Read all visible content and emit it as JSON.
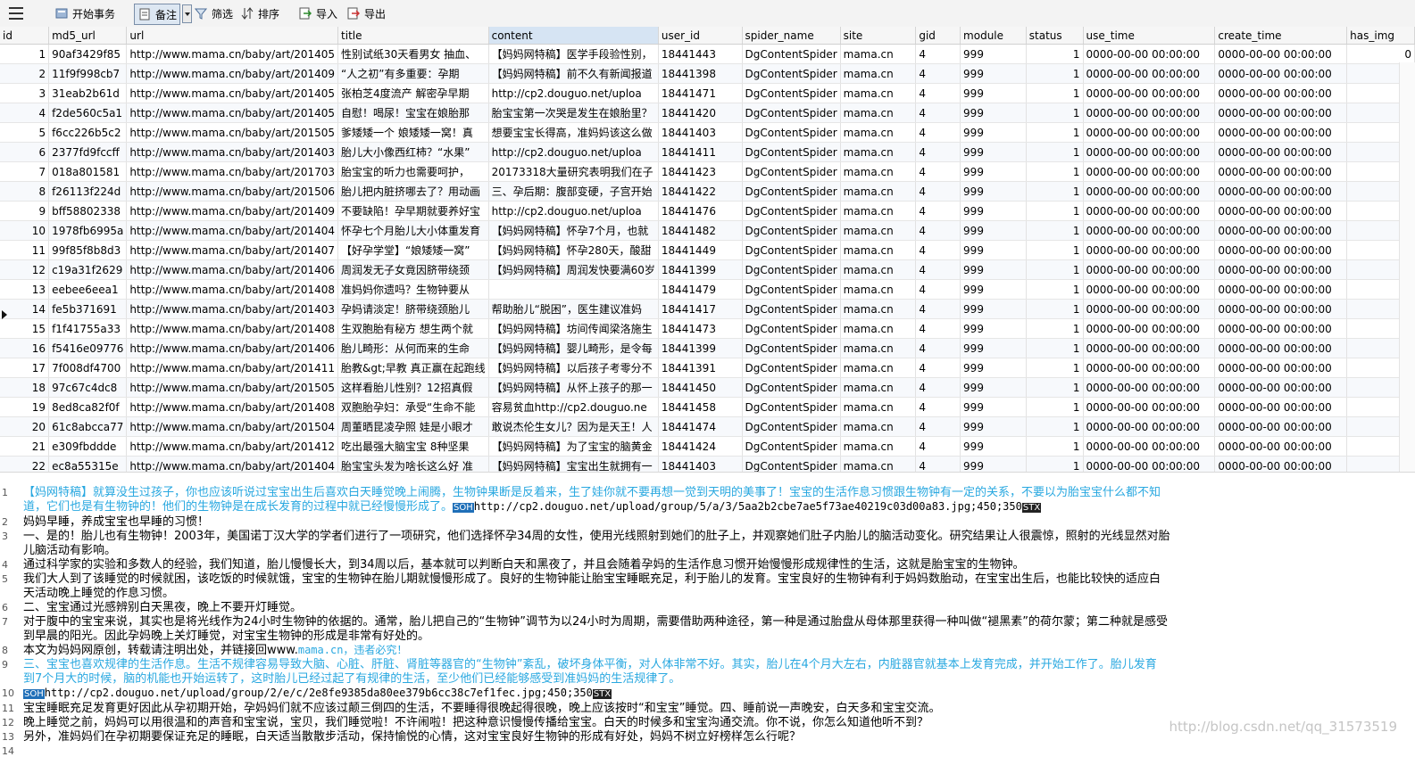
{
  "toolbar": {
    "begin": "开始事务",
    "remark": "备注",
    "filter": "筛选",
    "sort": "排序",
    "import": "导入",
    "export": "导出"
  },
  "columns": [
    "id",
    "md5_url",
    "url",
    "title",
    "content",
    "user_id",
    "spider_name",
    "site",
    "gid",
    "module",
    "status",
    "use_time",
    "create_time",
    "has_img"
  ],
  "rows": [
    [
      "1",
      "90af3429f85",
      "http://www.mama.cn/baby/art/201405",
      "性别试纸30天看男女 抽血、",
      "【妈妈网特稿】医学手段验性别，",
      "18441443",
      "DgContentSpider",
      "mama.cn",
      "4",
      "999",
      "1",
      "0000-00-00 00:00:00",
      "0000-00-00 00:00:00",
      "0"
    ],
    [
      "2",
      "11f9f998cb7",
      "http://www.mama.cn/baby/art/201409",
      "“人之初”有多重要：孕期",
      "【妈妈网特稿】前不久有新闻报道",
      "18441398",
      "DgContentSpider",
      "mama.cn",
      "4",
      "999",
      "1",
      "0000-00-00 00:00:00",
      "0000-00-00 00:00:00",
      "0"
    ],
    [
      "3",
      "31eab2b61d",
      "http://www.mama.cn/baby/art/201405",
      "张柏芝4度流产 解密孕早期",
      "http://cp2.douguo.net/uploa",
      "18441471",
      "DgContentSpider",
      "mama.cn",
      "4",
      "999",
      "1",
      "0000-00-00 00:00:00",
      "0000-00-00 00:00:00",
      "0"
    ],
    [
      "4",
      "f2de560c5a1",
      "http://www.mama.cn/baby/art/201405",
      "自慰！喝尿！宝宝在娘胎那",
      "胎宝宝第一次哭是发生在娘胎里？",
      "18441420",
      "DgContentSpider",
      "mama.cn",
      "4",
      "999",
      "1",
      "0000-00-00 00:00:00",
      "0000-00-00 00:00:00",
      "0"
    ],
    [
      "5",
      "f6cc226b5c2",
      "http://www.mama.cn/baby/art/201505",
      "爹矮矮一个 娘矮矮一窝！真",
      "想要宝宝长得高，准妈妈该这么做",
      "18441403",
      "DgContentSpider",
      "mama.cn",
      "4",
      "999",
      "1",
      "0000-00-00 00:00:00",
      "0000-00-00 00:00:00",
      "0"
    ],
    [
      "6",
      "2377fd9fccff",
      "http://www.mama.cn/baby/art/201403",
      "胎儿大小像西红柿？“水果”",
      "http://cp2.douguo.net/uploa",
      "18441411",
      "DgContentSpider",
      "mama.cn",
      "4",
      "999",
      "1",
      "0000-00-00 00:00:00",
      "0000-00-00 00:00:00",
      "0"
    ],
    [
      "7",
      "018a801581",
      "http://www.mama.cn/baby/art/201703",
      "胎宝宝的听力也需要呵护，",
      "20173318大量研究表明我们在子",
      "18441423",
      "DgContentSpider",
      "mama.cn",
      "4",
      "999",
      "1",
      "0000-00-00 00:00:00",
      "0000-00-00 00:00:00",
      "0"
    ],
    [
      "8",
      "f26113f224d",
      "http://www.mama.cn/baby/art/201506",
      "胎儿把内脏挤哪去了？用动画",
      "三、孕后期：腹部变硬，子宫开始",
      "18441422",
      "DgContentSpider",
      "mama.cn",
      "4",
      "999",
      "1",
      "0000-00-00 00:00:00",
      "0000-00-00 00:00:00",
      "0"
    ],
    [
      "9",
      "bff58802338",
      "http://www.mama.cn/baby/art/201409",
      "不要缺陷！孕早期就要养好宝",
      "http://cp2.douguo.net/uploa",
      "18441476",
      "DgContentSpider",
      "mama.cn",
      "4",
      "999",
      "1",
      "0000-00-00 00:00:00",
      "0000-00-00 00:00:00",
      "0"
    ],
    [
      "10",
      "1978fb6995a",
      "http://www.mama.cn/baby/art/201404",
      "怀孕七个月胎儿大小体重发育",
      "【妈妈网特稿】怀孕7个月，也就",
      "18441482",
      "DgContentSpider",
      "mama.cn",
      "4",
      "999",
      "1",
      "0000-00-00 00:00:00",
      "0000-00-00 00:00:00",
      "0"
    ],
    [
      "11",
      "99f85f8b8d3",
      "http://www.mama.cn/baby/art/201407",
      "【好孕学堂】“娘矮矮一窝”",
      "【妈妈网特稿】怀孕280天，酸甜",
      "18441449",
      "DgContentSpider",
      "mama.cn",
      "4",
      "999",
      "1",
      "0000-00-00 00:00:00",
      "0000-00-00 00:00:00",
      "0"
    ],
    [
      "12",
      "c19a31f2629",
      "http://www.mama.cn/baby/art/201406",
      "周润发无子女竟因脐带绕颈",
      "【妈妈网特稿】周润发快要满60岁",
      "18441399",
      "DgContentSpider",
      "mama.cn",
      "4",
      "999",
      "1",
      "0000-00-00 00:00:00",
      "0000-00-00 00:00:00",
      "0"
    ],
    [
      "13",
      "eebee6eea1",
      "http://www.mama.cn/baby/art/201408",
      "准妈妈你遗吗？生物钟要从",
      "",
      "18441479",
      "DgContentSpider",
      "mama.cn",
      "4",
      "999",
      "1",
      "0000-00-00 00:00:00",
      "0000-00-00 00:00:00",
      "0"
    ],
    [
      "14",
      "fe5b371691",
      "http://www.mama.cn/baby/art/201403",
      "孕妈请淡定！脐带绕颈胎儿",
      "帮助胎儿“脱困”，医生建议准妈",
      "18441417",
      "DgContentSpider",
      "mama.cn",
      "4",
      "999",
      "1",
      "0000-00-00 00:00:00",
      "0000-00-00 00:00:00",
      "0"
    ],
    [
      "15",
      "f1f41755a33",
      "http://www.mama.cn/baby/art/201408",
      "生双胞胎有秘方 想生两个就",
      "【妈妈网特稿】坊间传闻梁洛施生",
      "18441473",
      "DgContentSpider",
      "mama.cn",
      "4",
      "999",
      "1",
      "0000-00-00 00:00:00",
      "0000-00-00 00:00:00",
      "0"
    ],
    [
      "16",
      "f5416e09776",
      "http://www.mama.cn/baby/art/201406",
      "胎儿畸形：从何而来的生命",
      "【妈妈网特稿】婴儿畸形，是令每",
      "18441399",
      "DgContentSpider",
      "mama.cn",
      "4",
      "999",
      "1",
      "0000-00-00 00:00:00",
      "0000-00-00 00:00:00",
      "0"
    ],
    [
      "17",
      "7f008df4700",
      "http://www.mama.cn/baby/art/201411",
      "胎教&gt;早教 真正赢在起跑线",
      "【妈妈网特稿】以后孩子考零分不",
      "18441391",
      "DgContentSpider",
      "mama.cn",
      "4",
      "999",
      "1",
      "0000-00-00 00:00:00",
      "0000-00-00 00:00:00",
      "0"
    ],
    [
      "18",
      "97c67c4dc8",
      "http://www.mama.cn/baby/art/201505",
      "这样看胎儿性别？12招真假",
      "【妈妈网特稿】从怀上孩子的那一",
      "18441450",
      "DgContentSpider",
      "mama.cn",
      "4",
      "999",
      "1",
      "0000-00-00 00:00:00",
      "0000-00-00 00:00:00",
      "0"
    ],
    [
      "19",
      "8ed8ca82f0f",
      "http://www.mama.cn/baby/art/201408",
      "双胞胎孕妇：承受“生命不能",
      "容易贫血http://cp2.douguo.ne",
      "18441458",
      "DgContentSpider",
      "mama.cn",
      "4",
      "999",
      "1",
      "0000-00-00 00:00:00",
      "0000-00-00 00:00:00",
      "0"
    ],
    [
      "20",
      "61c8abcca77",
      "http://www.mama.cn/baby/art/201504",
      "周董晒昆凌孕照 娃是小眼才",
      "敢说杰伦生女儿？因为是天王！人",
      "18441474",
      "DgContentSpider",
      "mama.cn",
      "4",
      "999",
      "1",
      "0000-00-00 00:00:00",
      "0000-00-00 00:00:00",
      "0"
    ],
    [
      "21",
      "e309fbddde",
      "http://www.mama.cn/baby/art/201412",
      "吃出最强大脑宝宝 8种坚果",
      "【妈妈网特稿】为了宝宝的脑黄金",
      "18441424",
      "DgContentSpider",
      "mama.cn",
      "4",
      "999",
      "1",
      "0000-00-00 00:00:00",
      "0000-00-00 00:00:00",
      "0"
    ],
    [
      "22",
      "ec8a55315e",
      "http://www.mama.cn/baby/art/201404",
      "胎宝宝头发为啥长这么好 准",
      "【妈妈网特稿】宝宝出生就拥有一",
      "18441403",
      "DgContentSpider",
      "mama.cn",
      "4",
      "999",
      "1",
      "0000-00-00 00:00:00",
      "0000-00-00 00:00:00",
      "0"
    ]
  ],
  "editor": {
    "lines": [
      {
        "n": "1",
        "t": "【妈网特稿】就算没生过孩子，你也应该听说过宝宝出生后喜欢白天睡觉晚上闹腾，生物钟果断是反着来，生了娃你就不要再想一觉到天明的美事了！宝宝的生活作息习惯跟生物钟有一定的关系，不要以为胎宝宝什么都不知",
        "hl": true
      },
      {
        "n": "",
        "t": "道，它们也是有生物钟的！他们的生物钟是在成长发育的过程中就已经慢慢形成了。",
        "hl": true,
        "tag": "SOH",
        "url": "http://cp2.douguo.net/upload/group/5/a/3/5aa2b2cbe7ae5f73ae40219c03d00a83.jpg;450;350",
        "end": "STX"
      },
      {
        "n": "2",
        "t": "妈妈早睡，养成宝宝也早睡的习惯！"
      },
      {
        "n": "3",
        "t": "一、是的！胎儿也有生物钟！2003年，美国诺丁汉大学的学者们进行了一项研究，他们选择怀孕34周的女性，使用光线照射到她们的肚子上，并观察她们肚子内胎儿的脑活动变化。研究结果让人很震惊，照射的光线显然对胎"
      },
      {
        "n": "",
        "t": "儿脑活动有影响。"
      },
      {
        "n": "4",
        "t": "通过科学家的实验和多数人的经验，我们知道，胎儿慢慢长大，到34周以后，基本就可以判断白天和黑夜了，并且会随着孕妈的生活作息习惯开始慢慢形成规律性的生活，这就是胎宝宝的生物钟。"
      },
      {
        "n": "5",
        "t": "我们大人到了该睡觉的时候就困，该吃饭的时候就饿，宝宝的生物钟在胎儿期就慢慢形成了。良好的生物钟能让胎宝宝睡眠充足，利于胎儿的发育。宝宝良好的生物钟有利于妈妈数胎动，在宝宝出生后，也能比较快的适应白"
      },
      {
        "n": "",
        "t": "天活动晚上睡觉的作息习惯。"
      },
      {
        "n": "6",
        "t": "二、宝宝通过光感辨别白天黑夜，晚上不要开灯睡觉。"
      },
      {
        "n": "7",
        "t": "对于腹中的宝宝来说，其实也是将光线作为24小时生物钟的依据的。通常，胎儿把自己的“生物钟”调节为以24小时为周期，需要借助两种途径，第一种是通过胎盘从母体那里获得一种叫做“褪黑素”的荷尔蒙；第二种就是感受"
      },
      {
        "n": "",
        "t": "到早晨的阳光。因此孕妈晚上关灯睡觉，对宝宝生物钟的形成是非常有好处的。"
      },
      {
        "n": "8",
        "t": "本文为妈妈网原创，转载请注明出处，并链接回www.",
        "tail": "mama.cn，违者必究！"
      },
      {
        "n": "9",
        "t": "三、宝宝也喜欢规律的生活作息。生活不规律容易导致大脑、心脏、肝脏、肾脏等器官的“生物钟”紊乱，破坏身体平衡，对人体非常不好。其实，胎儿在4个月大左右，内脏器官就基本上发育完成，并开始工作了。胎儿发育",
        "hl": true
      },
      {
        "n": "",
        "t": "到7个月大的时候，脑的机能也开始运转了，这时胎儿已经过起了有规律的生活，至少他们已经能够感受到准妈妈的生活规律了。",
        "hl": true
      },
      {
        "n": "10",
        "t": "",
        "tag": "SOH",
        "url": "http://cp2.douguo.net/upload/group/2/e/c/2e8fe9385da80ee379b6cc38c7ef1fec.jpg;450;350",
        "end": "STX"
      },
      {
        "n": "11",
        "t": "宝宝睡眠充足发育更好因此从孕初期开始，孕妈妈们就不应该过颠三倒四的生活，不要睡得很晚起得很晚，晚上应该按时“和宝宝”睡觉。四、睡前说一声晚安，白天多和宝宝交流。"
      },
      {
        "n": "12",
        "t": "晚上睡觉之前，妈妈可以用很温和的声音和宝宝说，宝贝，我们睡觉啦！不许闹啦！把这种意识慢慢传播给宝宝。白天的时候多和宝宝沟通交流。你不说，你怎么知道他听不到？"
      },
      {
        "n": "13",
        "t": "另外，准妈妈们在孕初期要保证充足的睡眠，白天适当散散步活动，保持愉悦的心情，这对宝宝良好生物钟的形成有好处，妈妈不树立好榜样怎么行呢？"
      },
      {
        "n": "14",
        "t": ""
      }
    ]
  },
  "watermark": "http://blog.csdn.net/qq_31573519"
}
